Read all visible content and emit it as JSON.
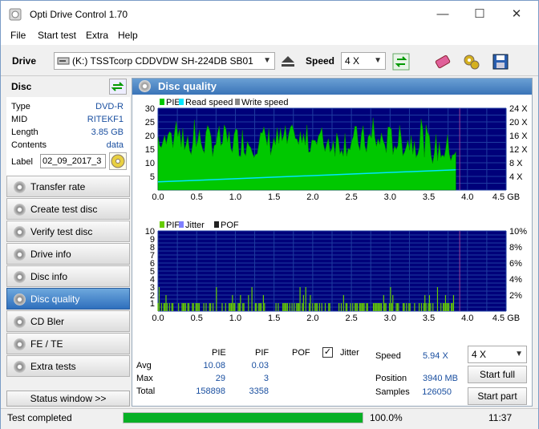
{
  "window": {
    "title": "Opti Drive Control 1.70",
    "min": "—",
    "max": "☐",
    "close": "✕"
  },
  "menu": [
    "File",
    "Start test",
    "Extra",
    "Help"
  ],
  "toolbar": {
    "drive_label": "Drive",
    "drive_value": "(K:)   TSSTcorp CDDVDW SH-224DB SB01",
    "speed_label": "Speed",
    "speed_value": "4 X"
  },
  "disc": {
    "header": "Disc",
    "rows": [
      {
        "k": "Type",
        "v": "DVD-R"
      },
      {
        "k": "MID",
        "v": "RITEKF1"
      },
      {
        "k": "Length",
        "v": "3.85 GB"
      },
      {
        "k": "Contents",
        "v": "data"
      }
    ],
    "label_key": "Label",
    "label_value": "02_09_2017_3"
  },
  "nav": [
    "Transfer rate",
    "Create test disc",
    "Verify test disc",
    "Drive info",
    "Disc info",
    "Disc quality",
    "CD Bler",
    "FE / TE",
    "Extra tests"
  ],
  "nav_active": 5,
  "status_window": "Status window >>",
  "panel_title": "Disc quality",
  "chart_data": [
    {
      "type": "area",
      "legend": [
        "PIE",
        "Read speed",
        "Write speed"
      ],
      "colors": {
        "pie": "#00c800",
        "read": "#00e5ff",
        "write": "#888888",
        "bg": "#00007a",
        "grid": "#1e3ca0"
      },
      "x_ticks": [
        "0.0",
        "0.5",
        "1.0",
        "1.5",
        "2.0",
        "2.5",
        "3.0",
        "3.5",
        "4.0",
        "4.5 GB"
      ],
      "xlim": [
        0,
        4.5
      ],
      "y_ticks": [
        "5",
        "10",
        "15",
        "20",
        "25",
        "30"
      ],
      "ylim": [
        0,
        30
      ],
      "y2_ticks": [
        "4 X",
        "8 X",
        "12 X",
        "16 X",
        "20 X",
        "24 X"
      ],
      "y2lim": [
        0,
        24
      ],
      "pie_end": 3.85,
      "pie_typical_range": [
        12,
        24
      ],
      "read_speed": {
        "x": [
          0,
          3.85
        ],
        "y": [
          2.4,
          5.94
        ]
      }
    },
    {
      "type": "bar",
      "legend": [
        "PIF",
        "Jitter",
        "POF"
      ],
      "colors": {
        "pif": "#66cc00",
        "jitter": "#8080ff",
        "pof": "#222222"
      },
      "x_ticks": [
        "0.0",
        "0.5",
        "1.0",
        "1.5",
        "2.0",
        "2.5",
        "3.0",
        "3.5",
        "4.0",
        "4.5 GB"
      ],
      "xlim": [
        0,
        4.5
      ],
      "y_ticks": [
        "1",
        "2",
        "3",
        "4",
        "5",
        "6",
        "7",
        "8",
        "9",
        "10"
      ],
      "ylim": [
        0,
        10
      ],
      "y2_ticks": [
        "2%",
        "4%",
        "6%",
        "8%",
        "10%"
      ],
      "y2lim": [
        0,
        10
      ],
      "pif_end": 3.85,
      "pif_typical_range": [
        0,
        2
      ]
    }
  ],
  "stats": {
    "col_pie": "PIE",
    "col_pif": "PIF",
    "col_pof": "POF",
    "jitter": "Jitter",
    "avg_label": "Avg",
    "max_label": "Max",
    "total_label": "Total",
    "avg_pie": "10.08",
    "avg_pif": "0.03",
    "max_pie": "29",
    "max_pif": "3",
    "total_pie": "158898",
    "total_pif": "3358",
    "speed_label": "Speed",
    "speed_value": "5.94 X",
    "position_label": "Position",
    "position_value": "3940 MB",
    "samples_label": "Samples",
    "samples_value": "126050",
    "speed_select": "4 X",
    "start_full": "Start full",
    "start_part": "Start part"
  },
  "statusbar": {
    "text": "Test completed",
    "percent": "100.0%",
    "progress": 1.0,
    "time": "11:37"
  }
}
